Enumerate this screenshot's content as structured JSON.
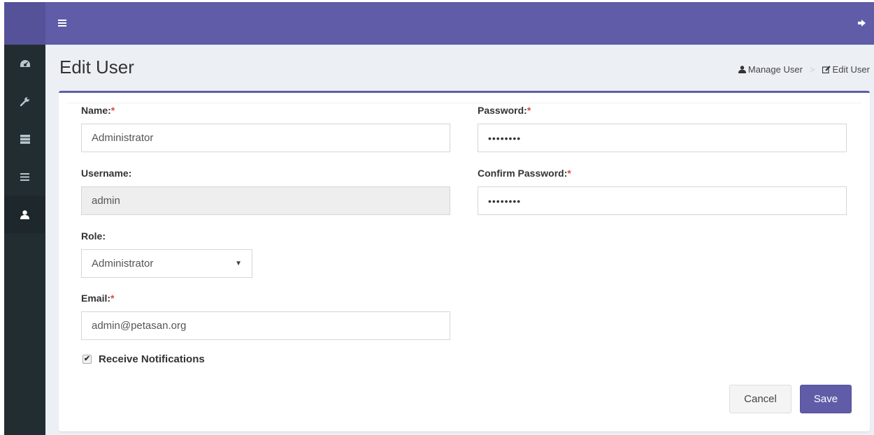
{
  "topbar": {
    "menu_icon": "hamburger-icon",
    "signout_icon": "sign-out-icon"
  },
  "sidebar": {
    "items": [
      {
        "icon": "dashboard-icon",
        "active": false
      },
      {
        "icon": "wrench-icon",
        "active": false
      },
      {
        "icon": "server-icon",
        "active": false
      },
      {
        "icon": "list-icon",
        "active": false
      },
      {
        "icon": "user-icon",
        "active": true
      }
    ]
  },
  "page": {
    "title": "Edit User"
  },
  "breadcrumb": {
    "item1": "Manage User",
    "item2": "Edit User"
  },
  "form": {
    "name_label": "Name:",
    "name_value": "Administrator",
    "username_label": "Username:",
    "username_value": "admin",
    "role_label": "Role:",
    "role_value": "Administrator",
    "email_label": "Email:",
    "email_value": "admin@petasan.org",
    "password_label": "Password:",
    "password_value": "••••••••",
    "confirm_label": "Confirm Password:",
    "confirm_value": "••••••••",
    "required_mark": "*",
    "notifications_label": "Receive Notifications",
    "notifications_checked": true
  },
  "buttons": {
    "cancel": "Cancel",
    "save": "Save"
  },
  "colors": {
    "accent": "#605ca8",
    "sidebar": "#222d32",
    "required": "#dd4b39"
  }
}
